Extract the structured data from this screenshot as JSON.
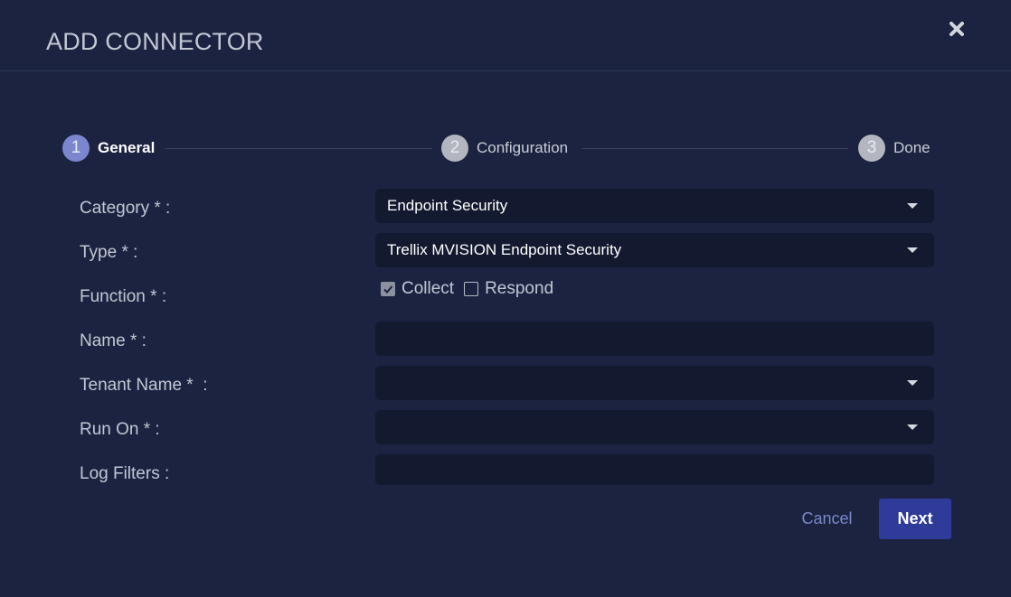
{
  "dialog": {
    "title": "ADD CONNECTOR"
  },
  "stepper": {
    "steps": [
      {
        "number": "1",
        "label": "General",
        "state": "active"
      },
      {
        "number": "2",
        "label": "Configuration",
        "state": "inactive"
      },
      {
        "number": "3",
        "label": "Done",
        "state": "inactive"
      }
    ]
  },
  "form": {
    "category": {
      "label": "Category * :",
      "value": "Endpoint Security"
    },
    "type": {
      "label": "Type * :",
      "value": "Trellix MVISION Endpoint Security"
    },
    "function": {
      "label": "Function * :",
      "options": [
        {
          "label": "Collect",
          "checked": true
        },
        {
          "label": "Respond",
          "checked": false
        }
      ]
    },
    "name": {
      "label": "Name * :",
      "value": ""
    },
    "tenant_name": {
      "label": "Tenant Name *  :",
      "value": ""
    },
    "run_on": {
      "label": "Run On * :",
      "value": ""
    },
    "log_filters": {
      "label": "Log Filters :",
      "value": ""
    }
  },
  "actions": {
    "cancel_label": "Cancel",
    "next_label": "Next"
  },
  "icons": {
    "close": "close-icon",
    "dropdown": "chevron-down-icon",
    "check": "checkmark-icon"
  },
  "colors": {
    "background": "#1b2341",
    "field": "#131a30",
    "accent": "#2f3b99",
    "step_active": "#7c86cf"
  }
}
